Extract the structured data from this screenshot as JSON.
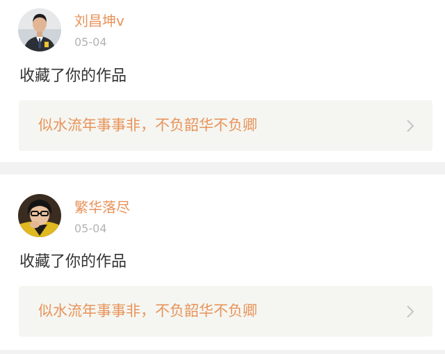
{
  "notifications": [
    {
      "username": "刘昌坤v",
      "time": "05-04",
      "action": "收藏了你的作品",
      "work_title": "似水流年事事非，不负韶华不负卿",
      "avatar_icon": "avatar-man-suit"
    },
    {
      "username": "繁华落尽",
      "time": "05-04",
      "action": "收藏了你的作品",
      "work_title": "似水流年事事非，不负韶华不负卿",
      "avatar_icon": "avatar-person-glasses"
    }
  ],
  "colors": {
    "accent": "#e8935a",
    "muted": "#b3b3b3",
    "text": "#333333",
    "card_bg": "#ffffff",
    "link_bg": "#f5f6f1",
    "page_bg": "#f2f2f2"
  }
}
